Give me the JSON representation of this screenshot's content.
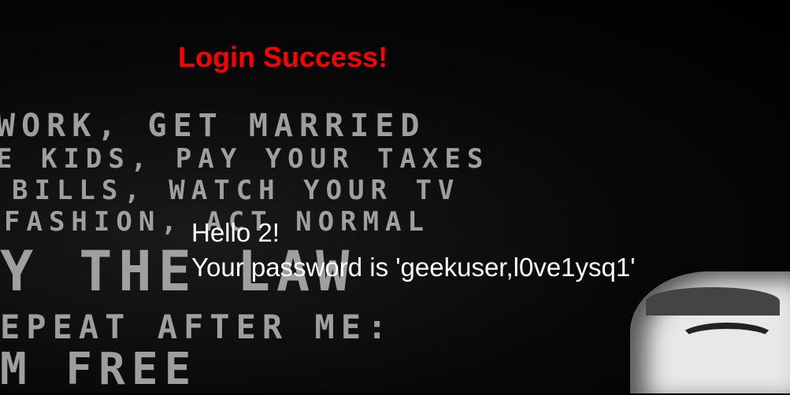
{
  "title": "Login Success!",
  "greeting": "Hello 2!",
  "password_message": "Your password is 'geekuser,l0ve1ysq1'",
  "background_poster": [
    "WORK, GET MARRIED",
    "E KIDS, PAY YOUR TAXES",
    "BILLS, WATCH YOUR TV",
    "FASHION, ACT NORMAL",
    "Y THE LAW",
    "EPEAT AFTER ME:",
    "M FREE"
  ],
  "colors": {
    "title": "#ff0000",
    "text": "#ffffff",
    "background": "#000000"
  }
}
